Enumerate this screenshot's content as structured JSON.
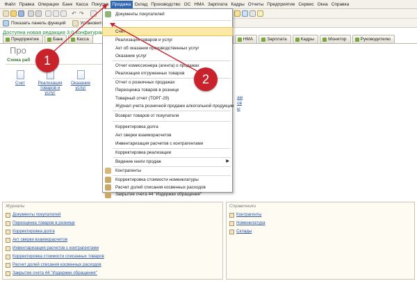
{
  "menubar": {
    "items": [
      "Файл",
      "Правка",
      "Операции",
      "Банк",
      "Касса",
      "Покупка",
      "Продажа",
      "Склад",
      "Производство",
      "ОС",
      "НМА",
      "Зарплата",
      "Кадры",
      "Отчеты",
      "Предприятие",
      "Сервис",
      "Окна",
      "Справка"
    ]
  },
  "toolbar": {
    "show_panel": "Показать панель функций",
    "install": "Установить основ"
  },
  "notice": "Доступна новая редакция 3.0 конфигурации",
  "tabs": {
    "left": [
      "Предприятие",
      "Банк",
      "Касса"
    ],
    "right": [
      "ОС",
      "НМА",
      "Зарплата",
      "Кадры",
      "Монитор",
      "Руководителю"
    ]
  },
  "main": {
    "section_title": "Про",
    "scheme_label": "Схема раб",
    "docs": [
      {
        "label": "Счет"
      },
      {
        "label": "Реализация товаров и услуг"
      },
      {
        "label": "Оказание услуг"
      }
    ],
    "right_snips": [
      "ам",
      "ов",
      "ы"
    ]
  },
  "dropdown": {
    "items": [
      "Документы покупателей",
      "Счет",
      "Реализация товаров и услуг",
      "Акт об оказании производственных услуг",
      "Оказание услуг",
      "Отчет комиссионера (агента) о продажах",
      "Реализация отгруженных товаров",
      "Отчет о розничных продажах",
      "Переоценка товаров в рознице",
      "Товарный отчет (ТОРГ-29)",
      "Журнал учета розничной продажи алкогольной продукции",
      "Возврат товаров от покупателя",
      "Корректировка долга",
      "Акт сверки взаиморасчетов",
      "Инвентаризация расчетов с контрагентами",
      "Корректировка реализации",
      "Ведение книги продаж",
      "Контрагенты",
      "Корректировка стоимости номенклатуры",
      "Расчет долей списания косвенных расходов",
      "Закрытие счета 44 \"Издержки обращения\""
    ]
  },
  "journals": {
    "title": "Журналы",
    "items": [
      "Документы покупателей",
      "Переоценка товаров в рознице",
      "Корректировка долга",
      "Акт сверки взаиморасчетов",
      "Инвентаризация расчетов с контрагентами",
      "Корректировка стоимости списанных товаров",
      "Расчет долей списания косвенных расходов",
      "Закрытие счета 44 \"Издержки обращения\""
    ]
  },
  "references": {
    "title": "Справочники",
    "items": [
      "Контрагенты",
      "Номенклатура",
      "Склады"
    ]
  },
  "badges": [
    "1",
    "2"
  ],
  "colors": {
    "badge": "#c8232c",
    "menu_active": "#2f66b3",
    "highlight": "#fde9a7",
    "link": "#2a55a8",
    "notice": "#1d8a3a"
  }
}
